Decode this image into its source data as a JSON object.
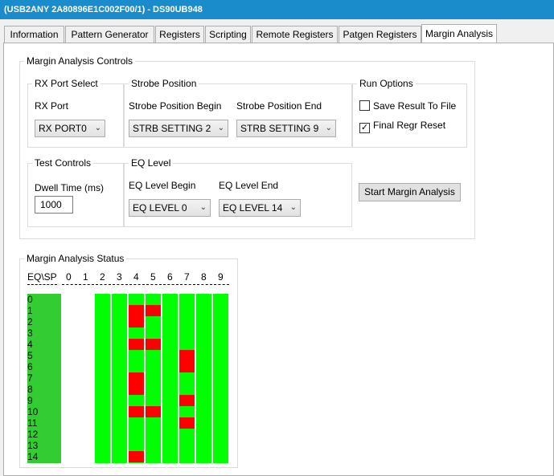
{
  "window": {
    "title": "(USB2ANY 2A80896E1C002F00/1) - DS90UB948"
  },
  "tabs": [
    {
      "label": "Information",
      "active": false
    },
    {
      "label": "Pattern Generator",
      "active": false
    },
    {
      "label": "Registers",
      "active": false
    },
    {
      "label": "Scripting",
      "active": false
    },
    {
      "label": "Remote Registers",
      "active": false
    },
    {
      "label": "Patgen Registers",
      "active": false
    },
    {
      "label": "Margin Analysis",
      "active": true
    }
  ],
  "controls": {
    "group_title": "Margin Analysis Controls",
    "rx_port_select": {
      "title": "RX Port Select",
      "label": "RX Port",
      "value": "RX PORT0"
    },
    "strobe_position": {
      "title": "Strobe Position",
      "begin_label": "Strobe Position Begin",
      "begin_value": "STRB SETTING 2",
      "end_label": "Strobe Position End",
      "end_value": "STRB SETTING 9"
    },
    "run_options": {
      "title": "Run Options",
      "save_result": {
        "label": "Save Result To File",
        "checked": false
      },
      "final_regr_reset": {
        "label": "Final Regr Reset",
        "checked": true
      }
    },
    "test_controls": {
      "title": "Test Controls",
      "dwell_label": "Dwell Time (ms)",
      "dwell_value": "1000"
    },
    "eq_level": {
      "title": "EQ Level",
      "begin_label": "EQ Level Begin",
      "begin_value": "EQ LEVEL 0",
      "end_label": "EQ Level End",
      "end_value": "EQ LEVEL 14"
    },
    "start_button": "Start Margin Analysis"
  },
  "status": {
    "title": "Margin Analysis Status",
    "corner": "EQ\\SP",
    "columns": [
      "0",
      "1",
      "2",
      "3",
      "4",
      "5",
      "6",
      "7",
      "8",
      "9"
    ],
    "rows": [
      "0",
      "1",
      "2",
      "3",
      "4",
      "5",
      "6",
      "7",
      "8",
      "9",
      "10",
      "11",
      "12",
      "13",
      "14"
    ],
    "active_columns": [
      2,
      3,
      4,
      5,
      6,
      7,
      8,
      9
    ],
    "fail_cells": [
      [
        1,
        4
      ],
      [
        1,
        5
      ],
      [
        2,
        4
      ],
      [
        4,
        4
      ],
      [
        4,
        5
      ],
      [
        5,
        7
      ],
      [
        6,
        7
      ],
      [
        7,
        4
      ],
      [
        8,
        4
      ],
      [
        9,
        7
      ],
      [
        10,
        4
      ],
      [
        10,
        5
      ],
      [
        11,
        7
      ],
      [
        14,
        4
      ]
    ],
    "colors": {
      "pass": "#00ff00",
      "fail": "#ff0000",
      "label_bg": "#33cc33"
    }
  }
}
